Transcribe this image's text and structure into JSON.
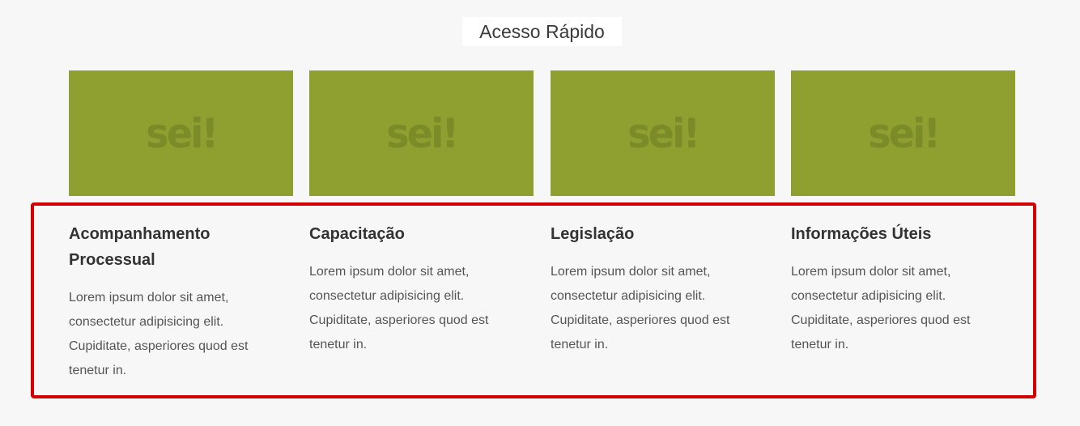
{
  "section": {
    "title": "Acesso Rápido"
  },
  "logo_text": "sei!",
  "cards": [
    {
      "title": "Acompanhamento Processual",
      "text": "Lorem ipsum dolor sit amet, consectetur adipisicing elit. Cupiditate, asperiores quod est tenetur in."
    },
    {
      "title": "Capacitação",
      "text": "Lorem ipsum dolor sit amet, consectetur adipisicing elit. Cupiditate, asperiores quod est tenetur in."
    },
    {
      "title": "Legislação",
      "text": "Lorem ipsum dolor sit amet, consectetur adipisicing elit. Cupiditate, asperiores quod est tenetur in."
    },
    {
      "title": "Informações Úteis",
      "text": "Lorem ipsum dolor sit amet, consectetur adipisicing elit. Cupiditate, asperiores quod est tenetur in."
    }
  ],
  "colors": {
    "card_image": "#8fa030",
    "logo": "#7a8b28",
    "highlight": "#d40000",
    "background": "#f7f7f7"
  }
}
